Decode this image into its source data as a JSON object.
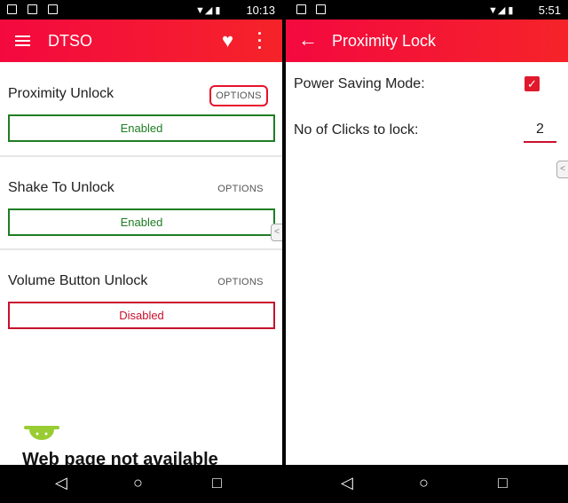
{
  "left": {
    "status": {
      "time": "10:13"
    },
    "toolbar": {
      "title": "DTSO"
    },
    "rows": [
      {
        "label": "Proximity Unlock",
        "options": "OPTIONS",
        "state": "Enabled",
        "highlighted": true
      },
      {
        "label": "Shake To Unlock",
        "options": "OPTIONS",
        "state": "Enabled"
      },
      {
        "label": "Volume Button Unlock",
        "options": "OPTIONS",
        "state": "Disabled"
      }
    ],
    "error_text": "Web page not available"
  },
  "right": {
    "status": {
      "time": "5:51"
    },
    "toolbar": {
      "title": "Proximity Lock"
    },
    "power_saving": {
      "label": "Power Saving Mode:",
      "checked": true
    },
    "clicks": {
      "label": "No of Clicks to lock:",
      "value": "2"
    }
  },
  "colors": {
    "accent": "#f4093f",
    "enabled": "#1e7d22",
    "disabled": "#c8102e"
  }
}
